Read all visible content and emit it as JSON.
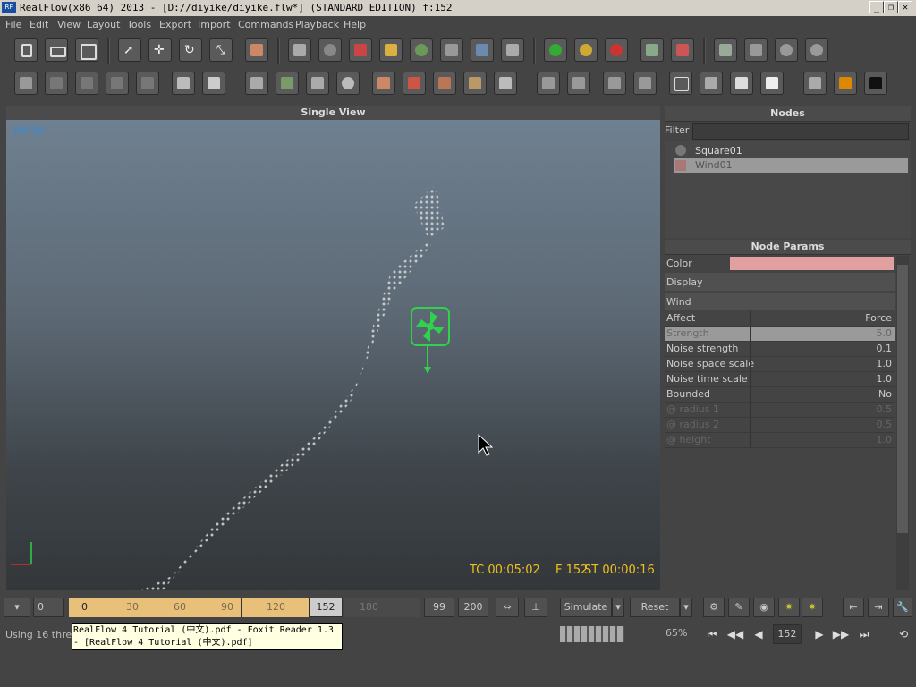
{
  "window": {
    "title": "RealFlow(x86_64) 2013 - [D://diyike/diyike.flw*] (STANDARD EDITION) f:152",
    "logo": "RF"
  },
  "menu": [
    "File",
    "Edit",
    "View",
    "Layout",
    "Tools",
    "Export",
    "Import",
    "Commands",
    "Playback",
    "Help"
  ],
  "viewport": {
    "header": "Single View",
    "camera": "persp",
    "tc": "TC 00:05:02",
    "frame": "F 152",
    "st": "ST 00:00:16"
  },
  "nodes": {
    "header": "Nodes",
    "filter_label": "Filter",
    "items": [
      "Square01",
      "Wind01"
    ]
  },
  "params": {
    "header": "Node Params",
    "color_label": "Color",
    "color_value": "#e3a0a0",
    "sections": [
      "Display",
      "Wind"
    ],
    "rows": [
      {
        "k": "Affect",
        "v": "Force"
      },
      {
        "k": "Strength",
        "v": "5.0"
      },
      {
        "k": "Noise strength",
        "v": "0.1"
      },
      {
        "k": "Noise space scale",
        "v": "1.0"
      },
      {
        "k": "Noise time scale",
        "v": "1.0"
      },
      {
        "k": "Bounded",
        "v": "No"
      },
      {
        "k": "@ radius 1",
        "v": "0.5"
      },
      {
        "k": "@ radius 2",
        "v": "0.5"
      },
      {
        "k": "@ height",
        "v": "1.0"
      }
    ]
  },
  "timeline": {
    "start": "0",
    "ticks": [
      "0",
      "30",
      "60",
      "90",
      "120"
    ],
    "current": "152",
    "after": "180",
    "end1": "99",
    "end2": "200"
  },
  "controls": {
    "simulate": "Simulate",
    "reset": "Reset",
    "percent": "65%",
    "frame": "152"
  },
  "status": {
    "threads": "Using 16 threa"
  },
  "tooltip": {
    "line1": "RealFlow 4 Tutorial (中文).pdf - Foxit Reader 1.3",
    "line2": "- [RealFlow 4 Tutorial (中文).pdf]"
  },
  "icons": [
    "logo-icon",
    "new-file-icon",
    "open-icon",
    "save-icon",
    "select-icon",
    "move-icon",
    "rotate-icon",
    "scale-icon"
  ]
}
